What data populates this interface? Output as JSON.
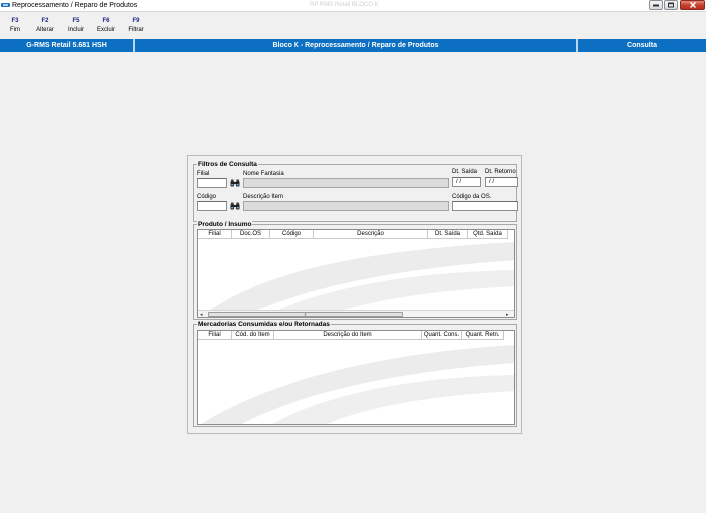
{
  "window": {
    "title": "Reprocessamento / Reparo de Produtos",
    "ghost_title": "RP RMS Retail BLOCO K"
  },
  "toolbar": {
    "items": [
      {
        "key": "F3",
        "label": "Fim"
      },
      {
        "key": "F2",
        "label": "Alterar"
      },
      {
        "key": "F5",
        "label": "Incluir"
      },
      {
        "key": "F6",
        "label": "Excluir"
      },
      {
        "key": "F9",
        "label": "Filtrar"
      }
    ]
  },
  "statusbar": {
    "app_version": "G-RMS Retail 5.681 HSH",
    "module": "Bloco K - Reprocessamento / Reparo de Produtos",
    "mode": "Consulta"
  },
  "filters": {
    "title": "Filtros de Consulta",
    "filial_label": "Filial",
    "nome_fantasia_label": "Nome Fantasia",
    "dt_saida_label": "Dt. Saída",
    "dt_saida_value": " / /",
    "dt_retorno_label": "Dt. Retorno",
    "dt_retorno_value": " / /",
    "codigo_label": "Código",
    "descricao_item_label": "Descrição Item",
    "codigo_os_label": "Código da OS."
  },
  "produto_insumo": {
    "title": "Produto / Insumo",
    "columns": [
      "Filial",
      "Doc.OS",
      "Código",
      "Descrição",
      "Dt. Saída",
      "Qtd. Saída"
    ]
  },
  "mercadorias": {
    "title": "Mercadorias Consumidas e/ou Retornadas",
    "columns": [
      "Filial",
      "Cód. do Item",
      "Descrição do Item",
      "Quant. Cons.",
      "Quant. Retn."
    ]
  },
  "colors": {
    "status_bar_blue": "#0c6fc2",
    "toolbar_key": "#1a237e",
    "close_button_red": "#c33d2b"
  }
}
